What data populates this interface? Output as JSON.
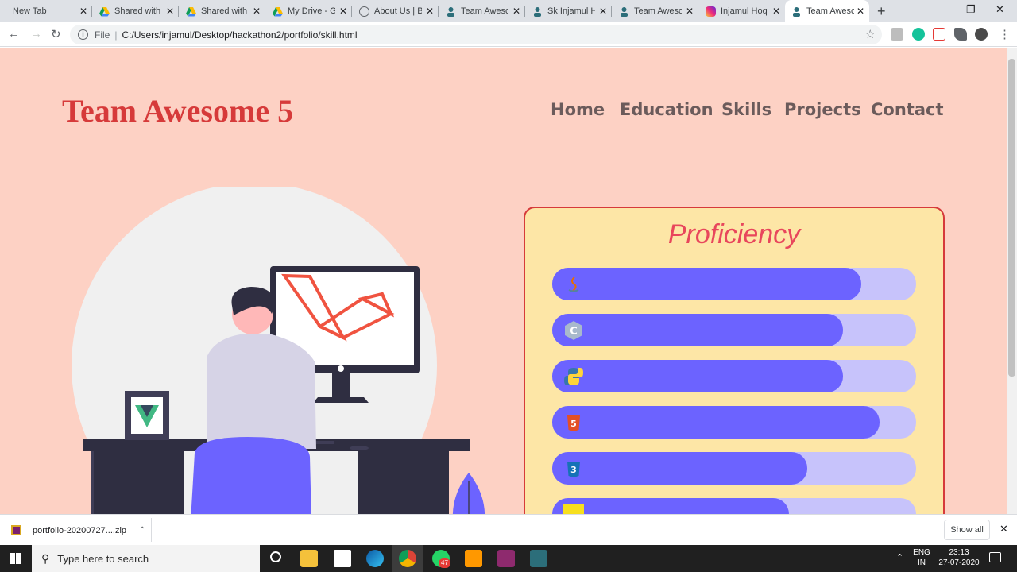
{
  "browser": {
    "tabs": [
      {
        "label": "New Tab"
      },
      {
        "label": "Shared with"
      },
      {
        "label": "Shared with"
      },
      {
        "label": "My Drive - G"
      },
      {
        "label": "About Us | B"
      },
      {
        "label": "Team Aweso"
      },
      {
        "label": "Sk Injamul H"
      },
      {
        "label": "Team Aweso"
      },
      {
        "label": "Injamul Hoq"
      },
      {
        "label": "Team Aweso"
      }
    ],
    "close_glyph": "✕",
    "new_tab_glyph": "+",
    "url_scheme_label": "File",
    "url": "C:/Users/injamul/Desktop/hackathon2/portfolio/skill.html"
  },
  "site": {
    "brand": "Team Awesome 5",
    "nav": [
      "Home",
      "Education",
      "Skills",
      "Projects",
      "Contact"
    ],
    "card_title": "Proficiency",
    "skills": [
      {
        "icon": "java-icon",
        "level": 0.85
      },
      {
        "icon": "c-lang-icon",
        "level": 0.8
      },
      {
        "icon": "python-icon",
        "level": 0.8
      },
      {
        "icon": "html5-icon",
        "level": 0.9
      },
      {
        "icon": "css3-icon",
        "level": 0.7
      },
      {
        "icon": "javascript-icon",
        "level": 0.65
      }
    ]
  },
  "downloads": {
    "file": "portfolio-20200727....zip",
    "show_all": "Show all"
  },
  "taskbar": {
    "search_placeholder": "Type here to search",
    "whatsapp_badge": "47",
    "lang_top": "ENG",
    "lang_bottom": "IN",
    "time": "23:13",
    "date": "27-07-2020"
  },
  "colors": {
    "page_bg": "#fdd1c4",
    "brand": "#d63a3a",
    "card_bg": "#fde6a6",
    "bar_fill": "#6c63ff",
    "bar_track": "#c7c3fb"
  }
}
